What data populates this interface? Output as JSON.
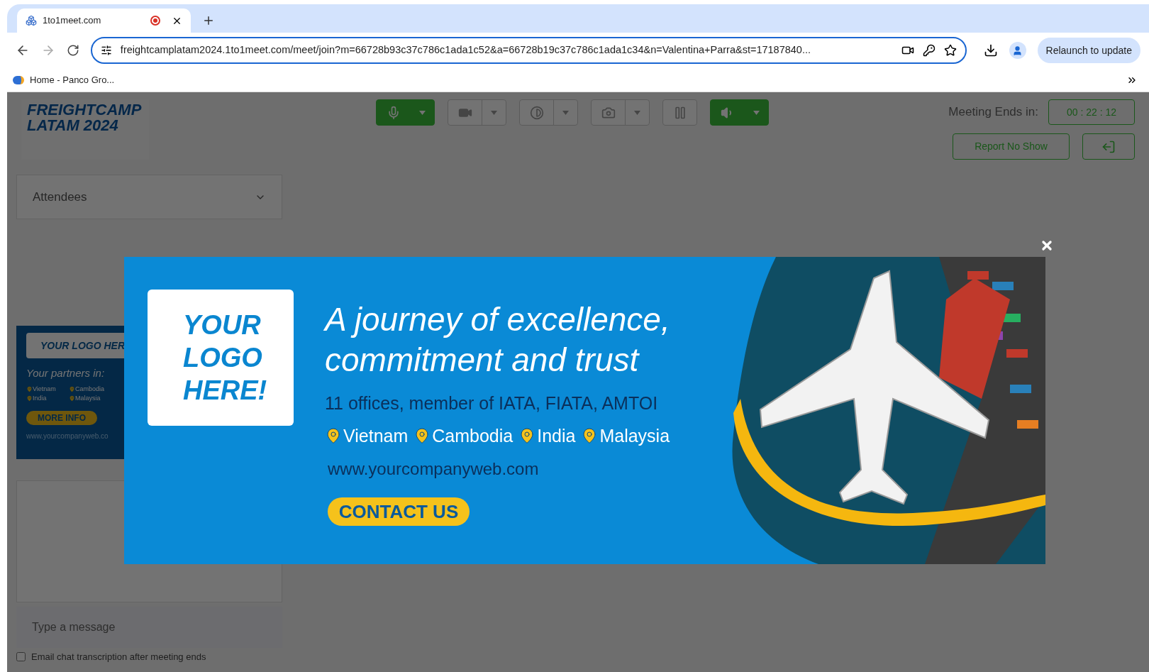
{
  "browser": {
    "tab": {
      "title": "1to1meet.com"
    },
    "url": "freightcamplatam2024.1to1meet.com/meet/join?m=66728b93c37c786c1ada1c52&a=66728b19c37c786c1ada1c34&n=Valentina+Parra&st=17187840...",
    "bookmark": "Home - Panco Gro...",
    "relaunch": "Relaunch to update"
  },
  "header": {
    "logo": [
      "FREIGHTCAMP",
      "LATAM 2024"
    ],
    "controls": [
      {
        "kind": "mic",
        "on": true,
        "dropdown": true
      },
      {
        "kind": "video",
        "on": false,
        "dropdown": true
      },
      {
        "kind": "contrast",
        "on": false,
        "dropdown": true
      },
      {
        "kind": "camera",
        "on": false,
        "dropdown": true
      },
      {
        "kind": "pause",
        "on": false,
        "dropdown": false
      },
      {
        "kind": "speaker",
        "on": true,
        "dropdown": true
      }
    ],
    "timer_label": "Meeting Ends in:",
    "timer": "00 : 22 : 12",
    "report": "Report No Show"
  },
  "sidebar": {
    "attendees": "Attendees",
    "ad": {
      "logo": "YOUR LOGO HER",
      "tagline": "Your partners in:",
      "locations": [
        "Vietnam",
        "Cambodia",
        "India",
        "Malaysia"
      ],
      "button": "MORE INFO",
      "website": "www.yourcompanyweb.co"
    },
    "chat_placeholder": "Type a message",
    "transcript": {
      "label": "Email chat transcription after meeting ends",
      "checked": false
    }
  },
  "modal": {
    "logo": [
      "YOUR",
      "LOGO",
      "HERE!"
    ],
    "headline": [
      "A journey of excellence,",
      "commitment and trust"
    ],
    "offices": "11 offices, member of IATA, FIATA, AMTOI",
    "locations": [
      "Vietnam",
      "Cambodia",
      "India",
      "Malaysia"
    ],
    "website": "www.yourcompanyweb.com",
    "cta": "CONTACT US"
  }
}
